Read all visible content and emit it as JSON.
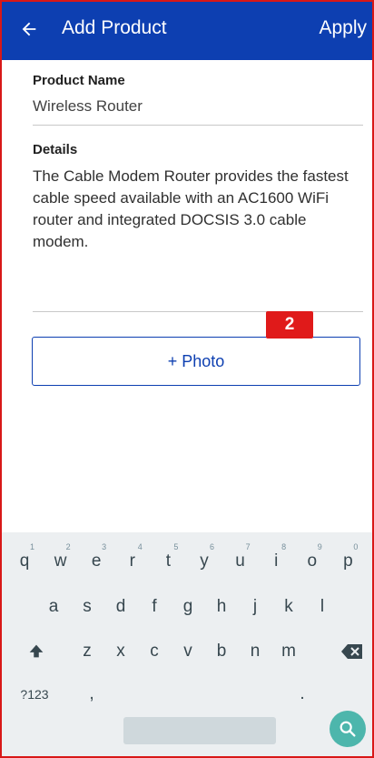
{
  "appbar": {
    "back_icon": "arrow-left-icon",
    "title": "Add Product",
    "apply_label": "Apply"
  },
  "product_name": {
    "label": "Product Name",
    "value": "Wireless Router"
  },
  "details": {
    "label": "Details",
    "value": "The Cable Modem Router provides the fastest cable speed available with an AC1600 WiFi router and integrated DOCSIS 3.0 cable modem."
  },
  "photo_button": {
    "label": "+ Photo"
  },
  "marker": {
    "text": "2"
  },
  "keyboard": {
    "row1": [
      {
        "key": "q",
        "hint": "1"
      },
      {
        "key": "w",
        "hint": "2"
      },
      {
        "key": "e",
        "hint": "3"
      },
      {
        "key": "r",
        "hint": "4"
      },
      {
        "key": "t",
        "hint": "5"
      },
      {
        "key": "y",
        "hint": "6"
      },
      {
        "key": "u",
        "hint": "7"
      },
      {
        "key": "i",
        "hint": "8"
      },
      {
        "key": "o",
        "hint": "9"
      },
      {
        "key": "p",
        "hint": "0"
      }
    ],
    "row2": [
      "a",
      "s",
      "d",
      "f",
      "g",
      "h",
      "j",
      "k",
      "l"
    ],
    "row3": [
      "z",
      "x",
      "c",
      "v",
      "b",
      "n",
      "m"
    ],
    "symbols_label": "?123",
    "comma_label": ",",
    "period_label": ".",
    "shift_icon": "shift-icon",
    "backspace_icon": "backspace-icon",
    "search_icon": "search-icon"
  }
}
